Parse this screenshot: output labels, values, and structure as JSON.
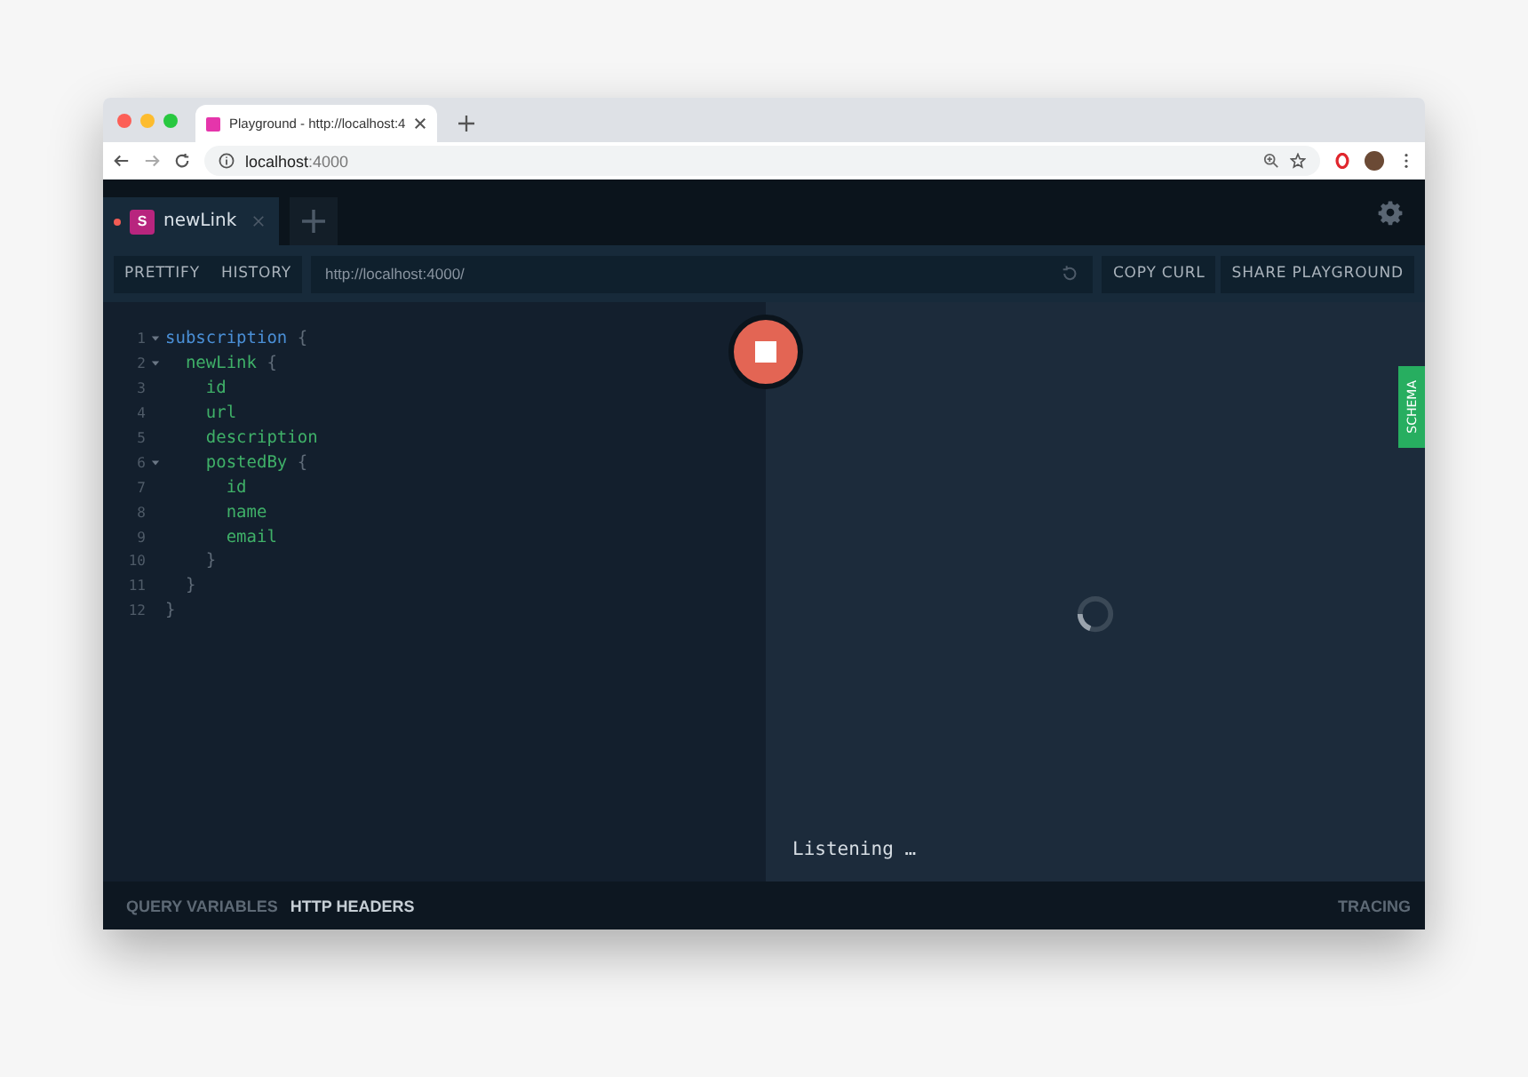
{
  "browser": {
    "tab_title": "Playground - http://localhost:4",
    "url_host": "localhost",
    "url_port": ":4000"
  },
  "playground_tabs": [
    {
      "label": "newLink",
      "badge": "S",
      "selected": true,
      "unsaved": true
    }
  ],
  "toolbar": {
    "buttons": [
      "PRETTIFY",
      "HISTORY"
    ],
    "endpoint": "http://localhost:4000/",
    "actions": [
      "COPY CURL",
      "SHARE PLAYGROUND"
    ]
  },
  "editor": {
    "lines": [
      {
        "number": "1",
        "foldable": true,
        "tokens": [
          {
            "kind": "keyword",
            "text": "subscription"
          },
          {
            "kind": "punct",
            "text": " {"
          }
        ]
      },
      {
        "number": "2",
        "foldable": true,
        "tokens": [
          {
            "kind": "field",
            "text": "  newLink"
          },
          {
            "kind": "punct",
            "text": " {"
          }
        ]
      },
      {
        "number": "3",
        "foldable": false,
        "tokens": [
          {
            "kind": "field",
            "text": "    id"
          }
        ]
      },
      {
        "number": "4",
        "foldable": false,
        "tokens": [
          {
            "kind": "field",
            "text": "    url"
          }
        ]
      },
      {
        "number": "5",
        "foldable": false,
        "tokens": [
          {
            "kind": "field",
            "text": "    description"
          }
        ]
      },
      {
        "number": "6",
        "foldable": true,
        "tokens": [
          {
            "kind": "field",
            "text": "    postedBy"
          },
          {
            "kind": "punct",
            "text": " {"
          }
        ]
      },
      {
        "number": "7",
        "foldable": false,
        "tokens": [
          {
            "kind": "field",
            "text": "      id"
          }
        ]
      },
      {
        "number": "8",
        "foldable": false,
        "tokens": [
          {
            "kind": "field",
            "text": "      name"
          }
        ]
      },
      {
        "number": "9",
        "foldable": false,
        "tokens": [
          {
            "kind": "field",
            "text": "      email"
          }
        ]
      },
      {
        "number": "10",
        "foldable": false,
        "tokens": [
          {
            "kind": "punct",
            "text": "    }"
          }
        ]
      },
      {
        "number": "11",
        "foldable": false,
        "tokens": [
          {
            "kind": "punct",
            "text": "  }"
          }
        ]
      },
      {
        "number": "12",
        "foldable": false,
        "tokens": [
          {
            "kind": "punct",
            "text": "}"
          }
        ]
      }
    ]
  },
  "results": {
    "status": "Listening …",
    "schema_tab": "SCHEMA"
  },
  "bottom_tabs": [
    {
      "label": "QUERY VARIABLES",
      "selected": false
    },
    {
      "label": "HTTP HEADERS",
      "selected": true
    }
  ],
  "tracing": "TRACING"
}
